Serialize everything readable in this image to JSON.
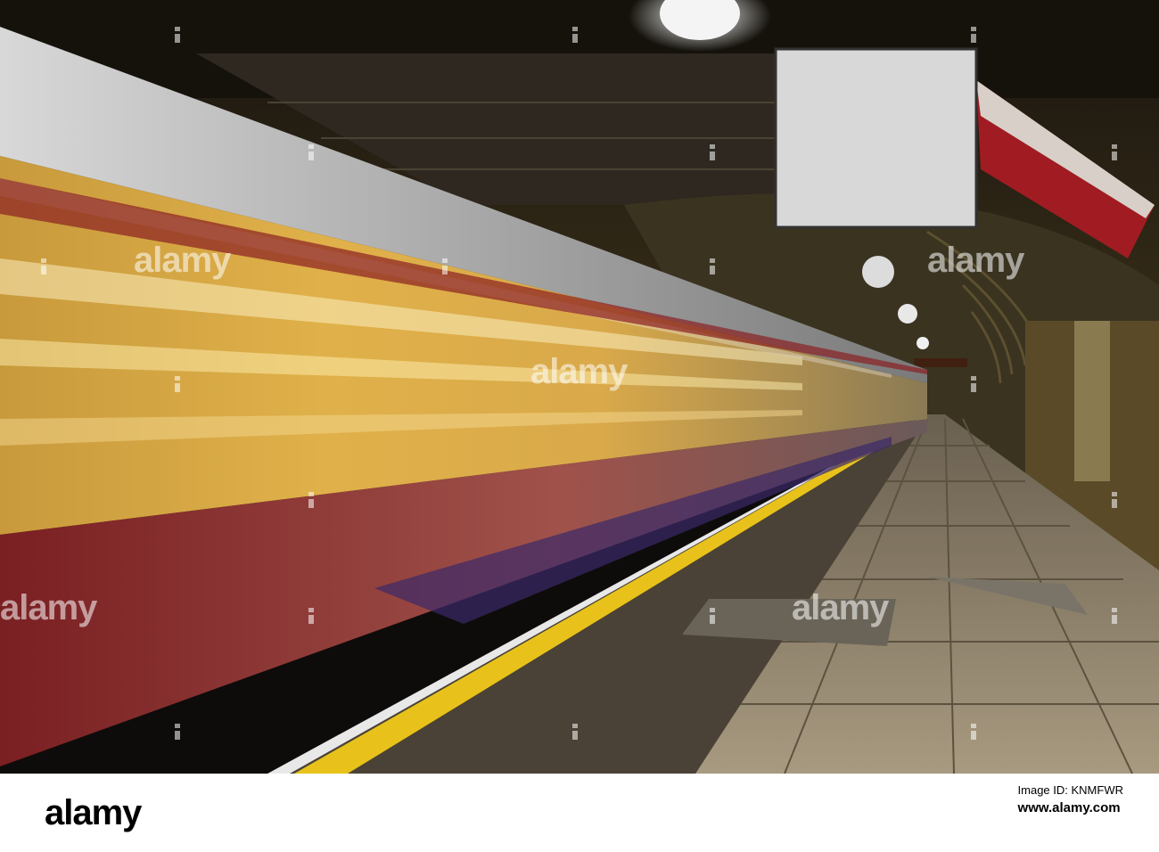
{
  "watermark": {
    "text": "alamy"
  },
  "footer": {
    "logo": "alamy",
    "image_id_label": "Image ID: KNMFWR",
    "url": "www.alamy.com"
  }
}
